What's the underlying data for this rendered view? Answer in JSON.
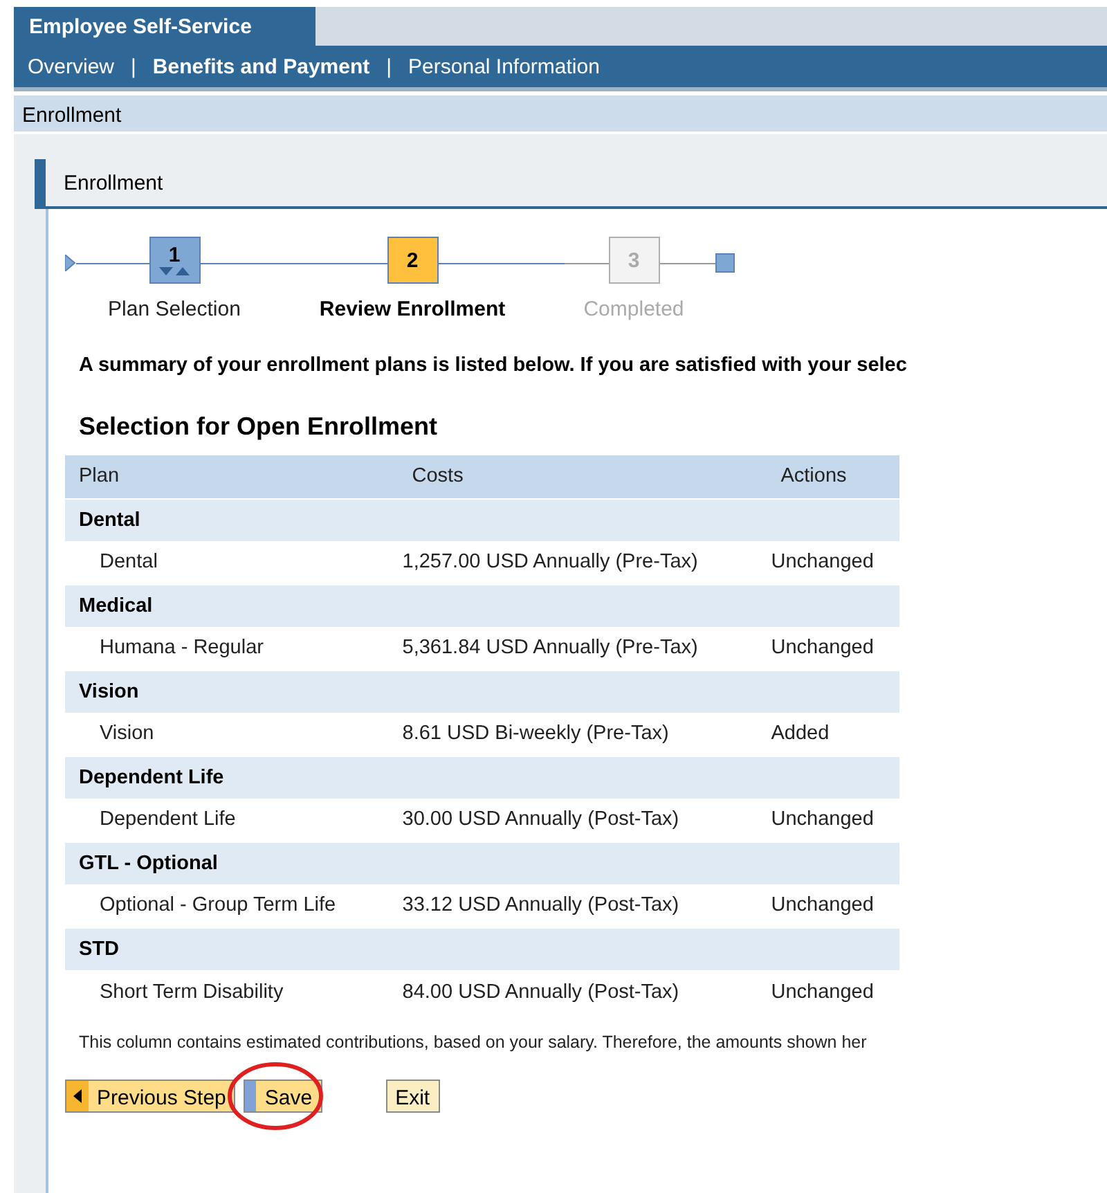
{
  "portal": {
    "title": "Employee Self-Service"
  },
  "nav": [
    {
      "label": "Overview",
      "selected": false
    },
    {
      "label": "Benefits and Payment",
      "selected": true
    },
    {
      "label": "Personal Information",
      "selected": false
    }
  ],
  "nav_separators": [
    "|",
    "|"
  ],
  "page_title": "Enrollment",
  "panel_title": "Enrollment",
  "steps": [
    {
      "number": "1",
      "label": "Plan Selection",
      "kind": "done"
    },
    {
      "number": "2",
      "label": "Review Enrollment",
      "kind": "current"
    },
    {
      "number": "3",
      "label": "Completed",
      "kind": "pending"
    }
  ],
  "intro": "A summary of your enrollment plans is listed below. If you are satisfied with your selec",
  "section_title": "Selection for Open Enrollment",
  "table": {
    "columns": [
      "Plan",
      "Costs",
      "Actions"
    ],
    "groups": [
      {
        "name": "Dental",
        "rows": [
          {
            "plan": "Dental",
            "cost": "1,257.00 USD Annually (Pre-Tax)",
            "action": "Unchanged"
          }
        ]
      },
      {
        "name": "Medical",
        "rows": [
          {
            "plan": "Humana - Regular",
            "cost": "5,361.84 USD Annually (Pre-Tax)",
            "action": "Unchanged"
          }
        ]
      },
      {
        "name": "Vision",
        "rows": [
          {
            "plan": "Vision",
            "cost": "8.61 USD Bi-weekly (Pre-Tax)",
            "action": "Added"
          }
        ]
      },
      {
        "name": "Dependent Life",
        "rows": [
          {
            "plan": "Dependent Life",
            "cost": "30.00 USD Annually (Post-Tax)",
            "action": "Unchanged"
          }
        ]
      },
      {
        "name": "GTL - Optional",
        "rows": [
          {
            "plan": "Optional - Group Term Life",
            "cost": "33.12 USD Annually (Post-Tax)",
            "action": "Unchanged"
          }
        ]
      },
      {
        "name": "STD",
        "rows": [
          {
            "plan": "Short Term Disability",
            "cost": "84.00 USD Annually (Post-Tax)",
            "action": "Unchanged"
          }
        ]
      }
    ]
  },
  "footnote": "This column contains estimated contributions, based on your salary. Therefore, the amounts shown her",
  "buttons": [
    {
      "label": "Previous Step",
      "kind": "back",
      "highlighted": false
    },
    {
      "label": "Save",
      "kind": "primary",
      "highlighted": true
    },
    {
      "label": "Exit",
      "kind": "plain",
      "highlighted": false
    }
  ]
}
